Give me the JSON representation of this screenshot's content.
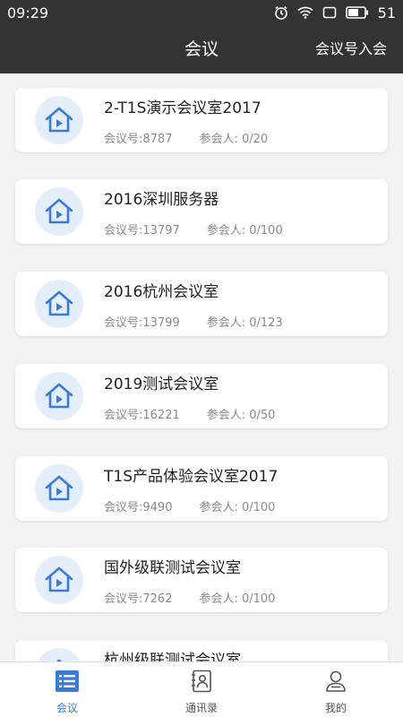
{
  "status": {
    "time": "09:29",
    "battery": "51"
  },
  "header": {
    "title": "会议",
    "join_label": "会议号入会"
  },
  "labels": {
    "meeting_no": "会议号:",
    "participants": "参会人: "
  },
  "rooms": [
    {
      "name": "2-T1S演示会议室2017",
      "meeting_no": "会议号:8787",
      "participants": "参会人:  0/20"
    },
    {
      "name": "2016深圳服务器",
      "meeting_no": "会议号:13797",
      "participants": "参会人:  0/100"
    },
    {
      "name": "2016杭州会议室",
      "meeting_no": "会议号:13799",
      "participants": "参会人:  0/123"
    },
    {
      "name": "2019测试会议室",
      "meeting_no": "会议号:16221",
      "participants": "参会人:  0/50"
    },
    {
      "name": "T1S产品体验会议室2017",
      "meeting_no": "会议号:9490",
      "participants": "参会人:  0/100"
    },
    {
      "name": "国外级联测试会议室",
      "meeting_no": "会议号:7262",
      "participants": "参会人:  0/100"
    },
    {
      "name": "杭州级联测试会议室",
      "meeting_no": "",
      "participants": ""
    }
  ],
  "nav": {
    "items": [
      {
        "label": "会议",
        "icon": "list-icon",
        "active": true
      },
      {
        "label": "通讯录",
        "icon": "contacts-icon",
        "active": false
      },
      {
        "label": "我的",
        "icon": "profile-icon",
        "active": false
      }
    ]
  },
  "colors": {
    "header_bg": "#333333",
    "accent": "#3a7bd5",
    "icon_bg": "#e4eefa",
    "page_bg": "#f2f2f2"
  }
}
